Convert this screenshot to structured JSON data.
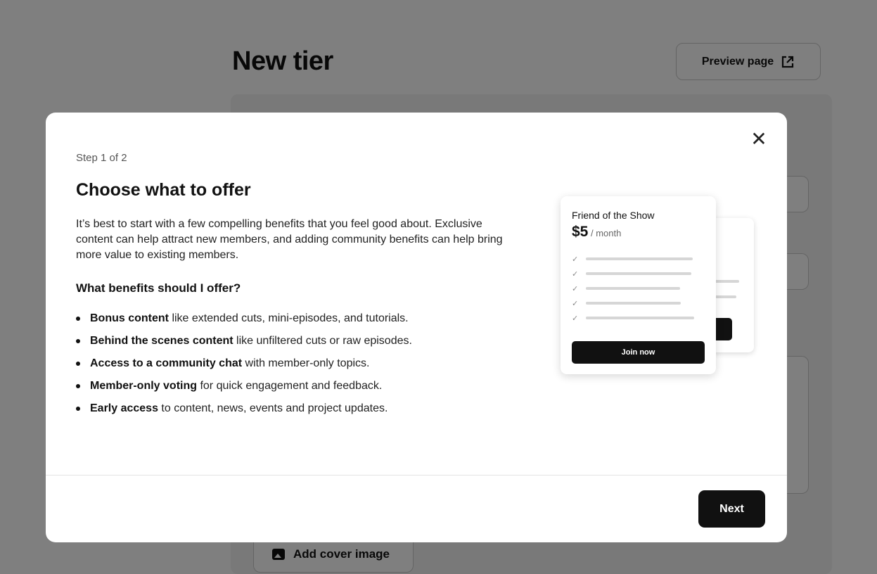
{
  "background": {
    "page_title": "New tier",
    "preview_label": "Preview page",
    "cover_label": "Add cover image"
  },
  "modal": {
    "step": "Step 1 of 2",
    "title": "Choose what to offer",
    "intro": "It’s best to start with a few compelling benefits that you feel good about. Exclusive content can help attract new members, and adding community benefits can help bring more value to existing members.",
    "subheading": "What benefits should I offer?",
    "benefits": [
      {
        "bold": "Bonus content",
        "rest": " like extended cuts, mini-episodes, and tutorials."
      },
      {
        "bold": "Behind the scenes content",
        "rest": " like unfiltered cuts or raw episodes."
      },
      {
        "bold": "Access to a community chat",
        "rest": " with member-only topics."
      },
      {
        "bold": "Member-only voting",
        "rest": " for quick engagement and feedback."
      },
      {
        "bold": "Early access",
        "rest": " to content, news, events and project updates."
      }
    ],
    "next_label": "Next",
    "close_glyph": "✕"
  },
  "illustration": {
    "tier_name": "Friend of the Show",
    "price": "$5",
    "per": " / month",
    "join_label": "Join now",
    "check_glyph": "✓"
  },
  "colors": {
    "primary": "#111111",
    "overlay": "rgba(0,0,0,0.5)"
  }
}
